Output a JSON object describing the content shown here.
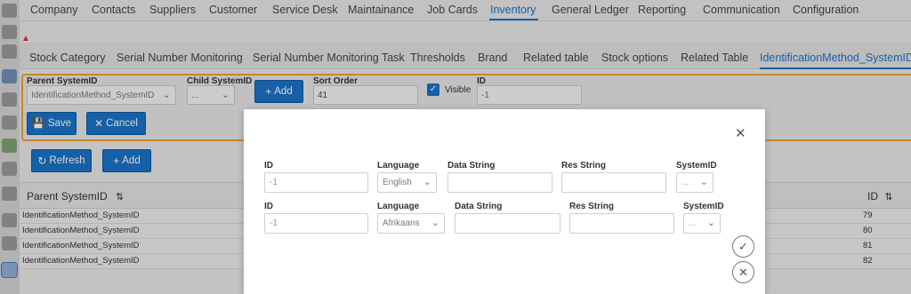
{
  "top_menu": {
    "items": [
      "Company",
      "Contacts",
      "Suppliers",
      "Customer",
      "Service Desk",
      "Maintainance",
      "Job Cards",
      "Inventory",
      "General Ledger",
      "Reporting",
      "Communication",
      "Configuration"
    ],
    "active": "Inventory"
  },
  "warning_icon": "warning-triangle-icon",
  "sub_tabs": {
    "items": [
      "Stock Category",
      "Serial Number Monitoring",
      "Serial Number Monitoring Task",
      "Thresholds",
      "Brand",
      "Related table",
      "Stock options",
      "Related Table",
      "IdentificationMethod_SystemID"
    ],
    "active": "IdentificationMethod_SystemID"
  },
  "editor": {
    "parent_label": "Parent SystemID",
    "parent_value": "IdentificationMethod_SystemID",
    "child_label": "Child SystemID",
    "child_value": "...",
    "add_label": "Add",
    "sort_label": "Sort Order",
    "sort_value": "41",
    "visible_label": "Visible",
    "id_label": "ID",
    "id_value": "-1",
    "save_label": "Save",
    "cancel_label": "Cancel"
  },
  "toolbar": {
    "refresh_label": "Refresh",
    "add_label": "Add"
  },
  "grid": {
    "col_parent": "Parent SystemID",
    "col_id": "ID",
    "rows": [
      {
        "parent": "IdentificationMethod_SystemID",
        "id": "79"
      },
      {
        "parent": "IdentificationMethod_SystemID",
        "id": "80"
      },
      {
        "parent": "IdentificationMethod_SystemID",
        "id": "81"
      },
      {
        "parent": "IdentificationMethod_SystemID",
        "id": "82"
      }
    ]
  },
  "modal": {
    "rows": [
      {
        "id_label": "ID",
        "id_value": "-1",
        "lang_label": "Language",
        "lang_value": "English",
        "data_label": "Data String",
        "data_value": "",
        "res_label": "Res String",
        "res_value": "",
        "sys_label": "SystemID",
        "sys_value": "..."
      },
      {
        "id_label": "ID",
        "id_value": "-1",
        "lang_label": "Language",
        "lang_value": "Afrikaans",
        "data_label": "Data String",
        "data_value": "",
        "res_label": "Res String",
        "res_value": "",
        "sys_label": "SystemID",
        "sys_value": "..."
      }
    ]
  },
  "colors": {
    "accent": "#1a73c8",
    "editor_border": "#f0a030",
    "warning": "#dd3333"
  }
}
